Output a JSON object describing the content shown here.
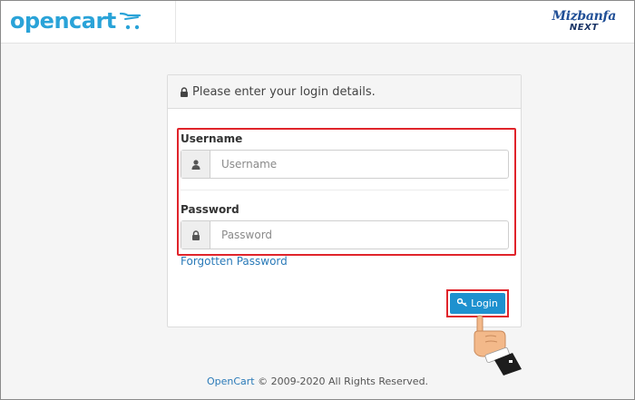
{
  "header": {
    "logo_text": "opencart",
    "brand_top": "Mizbanfa",
    "brand_bottom": "NEXT"
  },
  "login_panel": {
    "heading": "Please enter your login details.",
    "username": {
      "label": "Username",
      "placeholder": "Username",
      "value": ""
    },
    "password": {
      "label": "Password",
      "placeholder": "Password",
      "value": ""
    },
    "forgot_link": "Forgotten Password",
    "login_button": "Login"
  },
  "footer": {
    "link_text": "OpenCart",
    "copyright": "© 2009-2020 All Rights Reserved."
  },
  "colors": {
    "accent": "#1e91cf",
    "logo": "#2aa3d8",
    "highlight": "#e0242b",
    "link": "#2a7ab8"
  },
  "icons": [
    "cart-icon",
    "lock-icon",
    "user-icon",
    "key-icon",
    "pointing-hand-icon"
  ]
}
